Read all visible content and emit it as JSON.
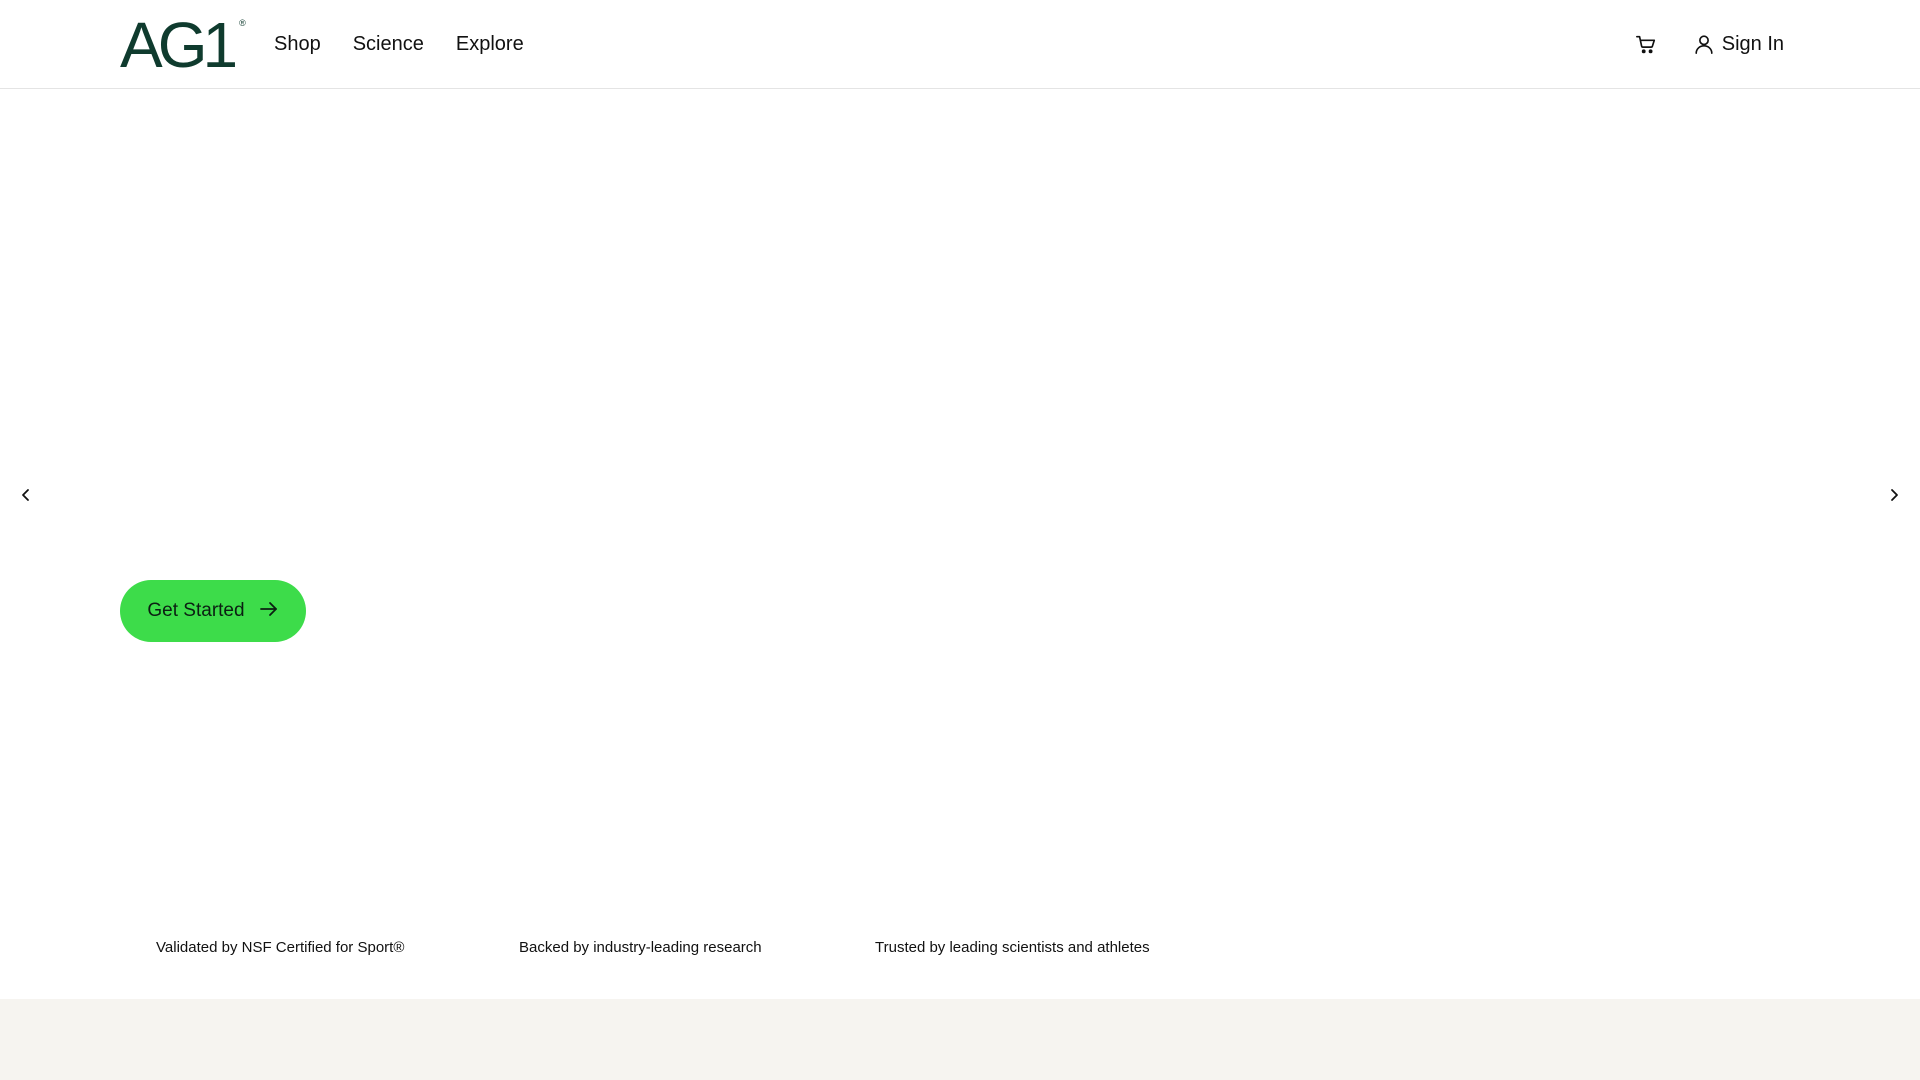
{
  "header": {
    "logo_text": "AG1",
    "logo_mark": "®",
    "nav": [
      {
        "label": "Shop"
      },
      {
        "label": "Science"
      },
      {
        "label": "Explore"
      }
    ],
    "cart_icon": "cart-icon",
    "user_icon": "user-icon",
    "sign_in_label": "Sign In"
  },
  "hero": {
    "prev_icon": "chevron-left-icon",
    "next_icon": "chevron-right-icon",
    "cta_label": "Get Started",
    "cta_icon": "arrow-right-icon"
  },
  "trust": [
    {
      "label": "Validated by NSF Certified for Sport®"
    },
    {
      "label": "Backed by industry-leading research"
    },
    {
      "label": "Trusted by leading scientists and athletes"
    }
  ],
  "colors": {
    "brand_green": "#3ddc4a",
    "logo_dark_green": "#0f3b2e",
    "footer_band": "#f6f4f0"
  }
}
